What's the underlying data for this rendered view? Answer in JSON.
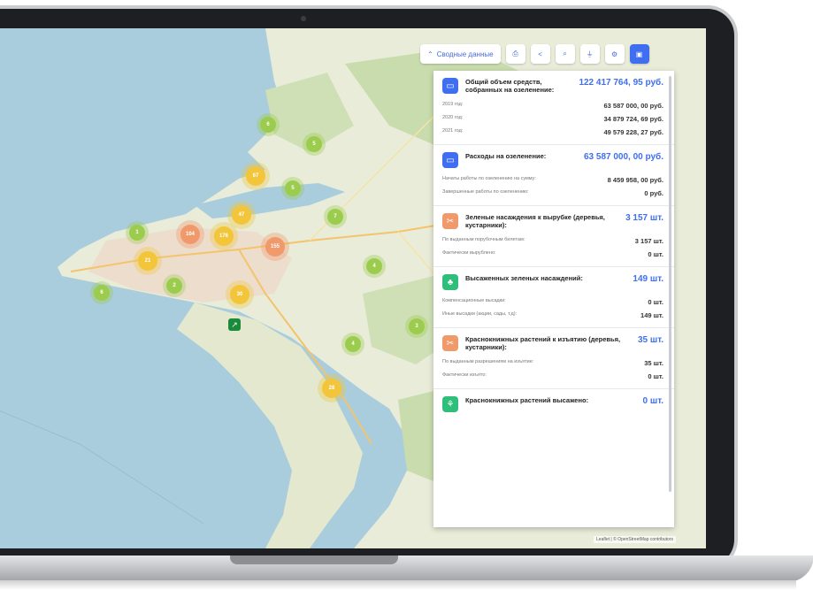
{
  "colors": {
    "accent": "#3f6ef0",
    "sea": "#a9cddc",
    "land": "#e9ecd9",
    "cluster_green": "#9ccc4e",
    "cluster_yellow": "#f2c53a",
    "cluster_orange": "#f0996a",
    "icon_blue": "#3f6ef0",
    "icon_orange": "#f0996a",
    "icon_green": "#2fbf7a"
  },
  "toolbar": {
    "summary_label": "Сводные данные",
    "summary_icon": "chevron-up-icon",
    "buttons": [
      {
        "name": "print-icon",
        "glyph": "⎙"
      },
      {
        "name": "share-icon",
        "glyph": "<"
      },
      {
        "name": "search-icon",
        "glyph": "⌕"
      },
      {
        "name": "filter-icon",
        "glyph": "⏚"
      },
      {
        "name": "settings-icon",
        "glyph": "⚙"
      },
      {
        "name": "chat-icon",
        "glyph": "▣"
      }
    ]
  },
  "map": {
    "attribution": "Leaflet | © OpenStreetMap contributors",
    "clusters": [
      {
        "label": "6",
        "color": "green"
      },
      {
        "label": "5",
        "color": "green"
      },
      {
        "label": "67",
        "color": "yellow"
      },
      {
        "label": "5",
        "color": "green"
      },
      {
        "label": "7",
        "color": "green"
      },
      {
        "label": "104",
        "color": "orange"
      },
      {
        "label": "176",
        "color": "yellow"
      },
      {
        "label": "155",
        "color": "orange"
      },
      {
        "label": "1",
        "color": "green"
      },
      {
        "label": "21",
        "color": "yellow"
      },
      {
        "label": "47",
        "color": "yellow"
      },
      {
        "label": "6",
        "color": "green"
      },
      {
        "label": "2",
        "color": "green"
      },
      {
        "label": "30",
        "color": "yellow"
      },
      {
        "label": "4",
        "color": "green"
      },
      {
        "label": "4",
        "color": "green"
      },
      {
        "label": "3",
        "color": "green"
      },
      {
        "label": "28",
        "color": "yellow"
      }
    ]
  },
  "panel": {
    "sections": [
      {
        "icon": "wallet-icon",
        "icon_color": "#3f6ef0",
        "title": "Общий объем средств, собранных на озеленение:",
        "total": "122 417 764, 95 руб.",
        "rows": [
          {
            "label": "2019 год:",
            "value": "63 587 000, 00 руб."
          },
          {
            "label": "2020 год:",
            "value": "34 879 724, 69 руб."
          },
          {
            "label": "2021 год:",
            "value": "49 579 228, 27 руб."
          }
        ]
      },
      {
        "icon": "wallet-icon",
        "icon_color": "#3f6ef0",
        "title": "Расходы на озеленение:",
        "total": "63 587 000, 00 руб.",
        "rows": [
          {
            "label": "Начаты работы по озеленению на сумму:",
            "value": "8 459 958, 00 руб."
          },
          {
            "label": "Завершенные работы по озеленению:",
            "value": "0 руб."
          }
        ]
      },
      {
        "icon": "axe-icon",
        "icon_color": "#f0996a",
        "title": "Зеленые насаждения к вырубке (деревья, кустарники):",
        "total": "3 157 шт.",
        "rows": [
          {
            "label": "По выданным порубочным билетам:",
            "value": "3 157 шт."
          },
          {
            "label": "Фактически вырублено:",
            "value": "0 шт."
          }
        ]
      },
      {
        "icon": "tree-icon",
        "icon_color": "#2fbf7a",
        "title": "Высаженных зеленых насаждений:",
        "total": "149 шт.",
        "rows": [
          {
            "label": "Компенсационные высадки:",
            "value": "0 шт."
          },
          {
            "label": "Иные высадки (акции, сады, т.д):",
            "value": "149 шт."
          }
        ]
      },
      {
        "icon": "axe-icon",
        "icon_color": "#f0996a",
        "title": "Краснокнижных растений к изъятию (деревья, кустарники):",
        "total": "35 шт.",
        "rows": [
          {
            "label": "По выданным разрешениям на изъятие:",
            "value": "35 шт."
          },
          {
            "label": "Фактически изъято:",
            "value": "0 шт."
          }
        ]
      },
      {
        "icon": "sprout-icon",
        "icon_color": "#2fbf7a",
        "title": "Краснокнижных растений высажено:",
        "total": "0 шт.",
        "rows": []
      }
    ]
  }
}
